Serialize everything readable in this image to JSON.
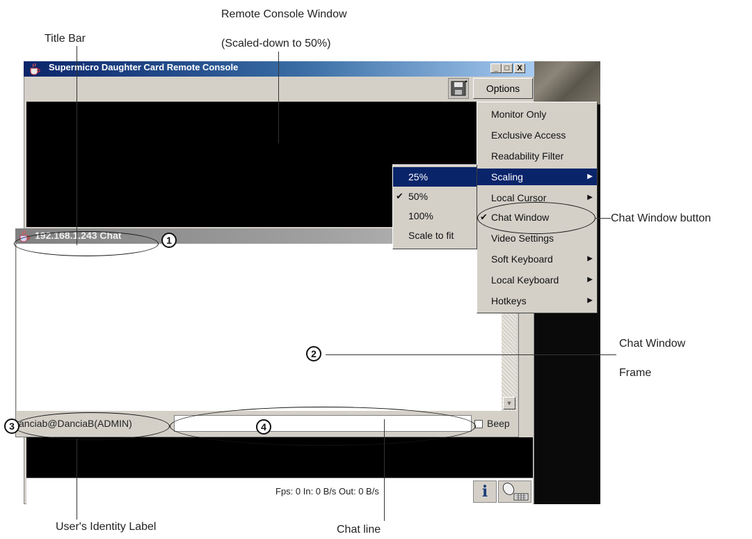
{
  "annotations": {
    "remote_console_title": "Remote Console Window",
    "remote_console_sub": "(Scaled-down to 50%)",
    "title_bar": "Title Bar",
    "chat_window_button": "Chat Window button",
    "chat_window_frame_line1": "Chat Window",
    "chat_window_frame_line2": "Frame",
    "users_identity_label": "User's Identity Label",
    "chat_line": "Chat line"
  },
  "badges": [
    "1",
    "2",
    "3",
    "4"
  ],
  "remote_console": {
    "title": "Supermicro Daughter Card Remote Console",
    "minimize": "_",
    "maximize": "□",
    "close": "X",
    "options_label": "Options",
    "status": "Fps: 0 In: 0 B/s Out: 0 B/s"
  },
  "options_menu": [
    {
      "label": "Monitor Only",
      "checked": false,
      "submenu": false
    },
    {
      "label": "Exclusive Access",
      "checked": false,
      "submenu": false
    },
    {
      "label": "Readability Filter",
      "checked": false,
      "submenu": false
    },
    {
      "label": "Scaling",
      "checked": false,
      "submenu": true,
      "highlighted": true
    },
    {
      "label": "Local Cursor",
      "checked": false,
      "submenu": true
    },
    {
      "label": "Chat Window",
      "checked": true,
      "submenu": false
    },
    {
      "label": "Video Settings",
      "checked": false,
      "submenu": false
    },
    {
      "label": "Soft Keyboard",
      "checked": false,
      "submenu": true
    },
    {
      "label": "Local Keyboard",
      "checked": false,
      "submenu": true
    },
    {
      "label": "Hotkeys",
      "checked": false,
      "submenu": true
    }
  ],
  "scaling_submenu": [
    {
      "label": "25%",
      "checked": false,
      "highlighted": true
    },
    {
      "label": "50%",
      "checked": true,
      "highlighted": false
    },
    {
      "label": "100%",
      "checked": false,
      "highlighted": false
    },
    {
      "label": "Scale to fit",
      "checked": false,
      "highlighted": false
    }
  ],
  "chat": {
    "title": "192.168.1.243 Chat",
    "identity": "anciab@DanciaB(ADMIN)",
    "input_value": "",
    "beep_label": "Beep",
    "beep_checked": false
  },
  "icons": {
    "java": "java-cup-icon",
    "save": "floppy-disk-icon",
    "info": "info-icon",
    "mouse": "mouse-keyboard-icon"
  },
  "colors": {
    "title_active": "#0a246a",
    "title_inactive": "#808080",
    "menu_bg": "#d4d0c8",
    "highlight": "#0a246a"
  }
}
